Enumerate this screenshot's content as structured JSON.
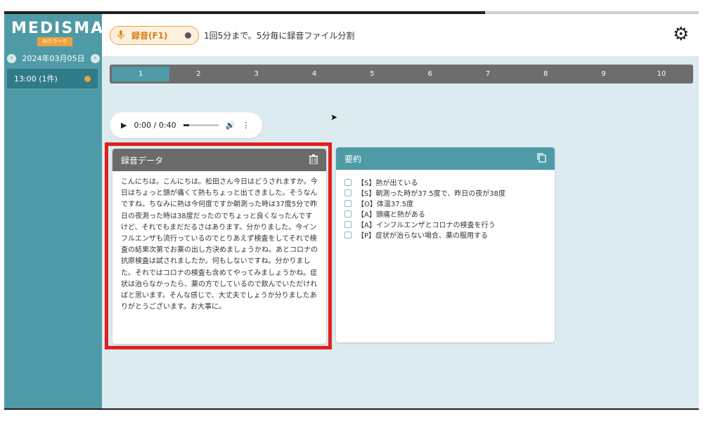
{
  "app": {
    "logo": "MEDISMA",
    "logo_sub": "AIクラーク"
  },
  "sidebar": {
    "date": "2024年03月05日",
    "prev_icon": "chevron-left-icon",
    "next_icon": "chevron-right-icon",
    "slot_label": "13:00 (1件)",
    "slot_dot_color": "#f0a23e"
  },
  "header": {
    "record_button_label": "録音(F1)",
    "record_note": "1回5分まで。5分毎に録音ファイル分割",
    "settings_icon": "gear-icon"
  },
  "pages": [
    "1",
    "2",
    "3",
    "4",
    "5",
    "6",
    "7",
    "8",
    "9",
    "10"
  ],
  "active_page": "1",
  "audio": {
    "time": "0:00 / 0:40"
  },
  "recording_card": {
    "title": "録音データ",
    "text": "こんにちは。こんにちは。松田さん今日はどうされますか。今日はちょっと頭が痛くて熱もちょっと出てきました。そうなんですね。ちなみに熱は今何度ですか朝測った時は37度5分で昨日の夜測った時は38度だったのでちょっと良くなったんですけど、それでもまだだるさはあります。分かりました。今インフルエンザも流行っているのでとりあえず検査をしてそれで検査の結果次第でお薬の出し方決めましょうかね。あとコロナの抗原検査は試されましたか。何もしないですね。分かりました。それではコロナの検査も含めてやってみましょうかね。症状は治らなかったら、薬の方でしているので飲んでいただければと思います。そんな感じで、大丈夫でしょうか分りましたありがとうございます。お大事に。"
  },
  "summary_card": {
    "title": "要約",
    "items": [
      "【S】熱が出ている",
      "【S】朝測った時が37.5度で、昨日の夜が38度",
      "【O】体温37.5度",
      "【A】頭痛と熱がある",
      "【A】インフルエンザとコロナの検査を行う",
      "【P】症状が治らない場合、薬の服用する"
    ]
  },
  "colors": {
    "teal": "#4e9ba7",
    "orange": "#f0a23e",
    "highlight": "#e02020"
  }
}
